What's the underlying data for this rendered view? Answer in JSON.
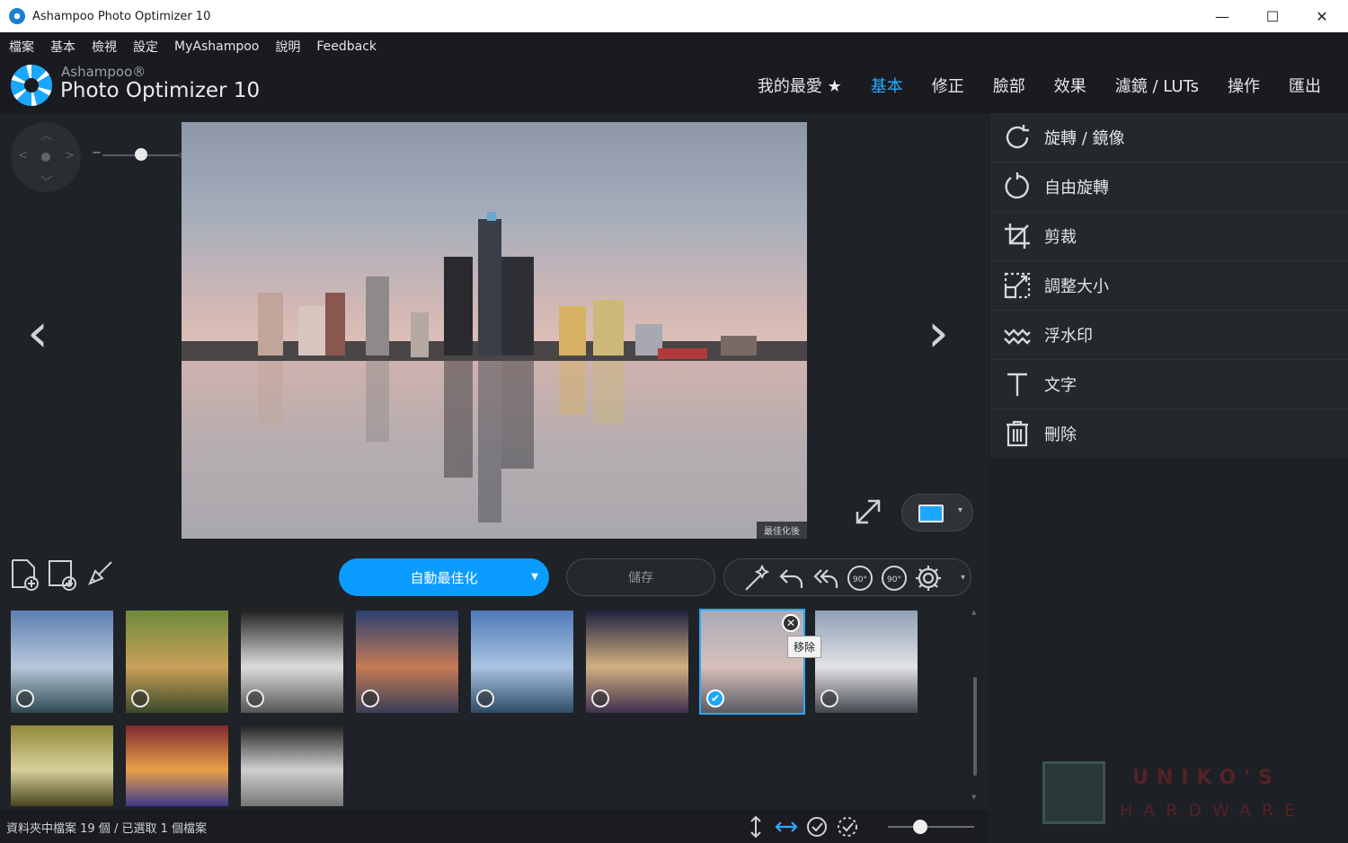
{
  "window": {
    "title": "Ashampoo Photo Optimizer 10",
    "controls": [
      "—",
      "☐",
      "✕"
    ]
  },
  "menu": [
    "檔案",
    "基本",
    "檢視",
    "設定",
    "MyAshampoo",
    "說明",
    "Feedback"
  ],
  "brand": {
    "small": "Ashampoo®",
    "big": "Photo Optimizer 10"
  },
  "nav_tabs": [
    {
      "label": "我的最愛 ★",
      "active": false
    },
    {
      "label": "基本",
      "active": true
    },
    {
      "label": "修正",
      "active": false
    },
    {
      "label": "臉部",
      "active": false
    },
    {
      "label": "效果",
      "active": false
    },
    {
      "label": "濾鏡 / LUTs",
      "active": false
    },
    {
      "label": "操作",
      "active": false
    },
    {
      "label": "匯出",
      "active": false
    }
  ],
  "side_panel": [
    {
      "label": "旋轉 / 鏡像",
      "icon": "rotate-mirror-icon"
    },
    {
      "label": "自由旋轉",
      "icon": "free-rotate-icon"
    },
    {
      "label": "剪裁",
      "icon": "crop-icon"
    },
    {
      "label": "調整大小",
      "icon": "resize-icon"
    },
    {
      "label": "浮水印",
      "icon": "watermark-icon"
    },
    {
      "label": "文字",
      "icon": "text-icon"
    },
    {
      "label": "刪除",
      "icon": "delete-icon"
    }
  ],
  "viewer": {
    "optimized_label": "最佳化後"
  },
  "toolbar": {
    "auto_label": "自動最佳化",
    "save_label": "儲存"
  },
  "thumbnails": [
    {
      "name": "lofoten",
      "selected": false,
      "colors": [
        "#5d7fb0",
        "#b7c7d9",
        "#2e4a55"
      ]
    },
    {
      "name": "old-truck",
      "selected": false,
      "colors": [
        "#6d8a3a",
        "#c9a05a",
        "#3b4a2a"
      ]
    },
    {
      "name": "bw-stairs",
      "selected": false,
      "colors": [
        "#222",
        "#ddd",
        "#555"
      ]
    },
    {
      "name": "sunset-bay",
      "selected": false,
      "colors": [
        "#2b3f70",
        "#c57a55",
        "#3a3f58"
      ]
    },
    {
      "name": "red-house",
      "selected": false,
      "colors": [
        "#4f7ab9",
        "#a9c4e2",
        "#2d4c66"
      ]
    },
    {
      "name": "night-city",
      "selected": false,
      "colors": [
        "#1f2240",
        "#d0b080",
        "#403050"
      ]
    },
    {
      "name": "detroit-skyline",
      "selected": true,
      "colors": [
        "#a7abb8",
        "#d8c0bb",
        "#5a5a62"
      ]
    },
    {
      "name": "bled-island",
      "selected": false,
      "colors": [
        "#8ea0b4",
        "#e2e2e6",
        "#44484f"
      ]
    },
    {
      "name": "buddha-face",
      "selected": false,
      "colors": [
        "#8f8a3a",
        "#d8d09a",
        "#4a4520"
      ]
    },
    {
      "name": "incense",
      "selected": false,
      "colors": [
        "#7d2a2e",
        "#e8a04a",
        "#3d3a88"
      ]
    },
    {
      "name": "bw-gondolas",
      "selected": false,
      "colors": [
        "#222",
        "#cfcfcf",
        "#777"
      ]
    }
  ],
  "tooltip": "移除",
  "status": {
    "text": "資料夾中檔案 19 個 / 已選取 1 個檔案"
  },
  "watermark": {
    "line1": "UNIKO'S",
    "line2": "HARDWARE"
  }
}
